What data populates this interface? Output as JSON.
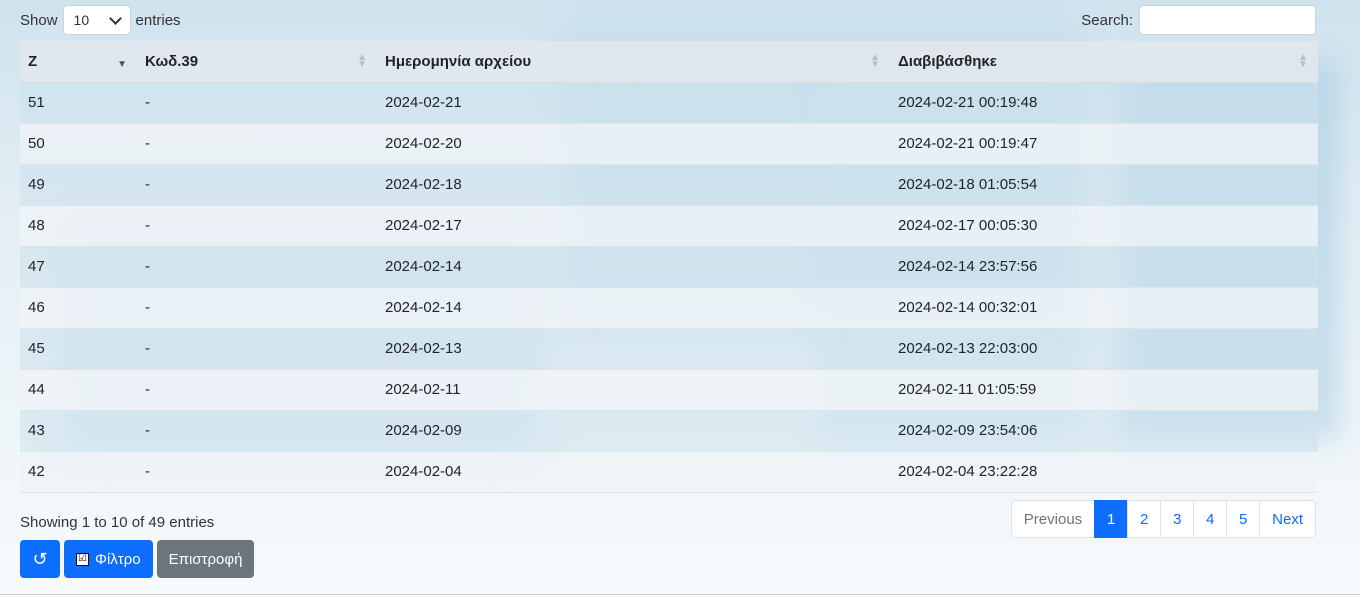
{
  "length_menu": {
    "prefix": "Show",
    "selected": "10",
    "suffix": "entries"
  },
  "search": {
    "label": "Search:",
    "value": "",
    "placeholder": ""
  },
  "table": {
    "columns": [
      "Z",
      "Κωδ.39",
      "Ημερομηνία αρχείου",
      "Διαβιβάσθηκε"
    ],
    "rows": [
      {
        "z": "51",
        "code39": "-",
        "file_date": "2024-02-21",
        "transmitted": "2024-02-21 00:19:48"
      },
      {
        "z": "50",
        "code39": "-",
        "file_date": "2024-02-20",
        "transmitted": "2024-02-21 00:19:47"
      },
      {
        "z": "49",
        "code39": "-",
        "file_date": "2024-02-18",
        "transmitted": "2024-02-18 01:05:54"
      },
      {
        "z": "48",
        "code39": "-",
        "file_date": "2024-02-17",
        "transmitted": "2024-02-17 00:05:30"
      },
      {
        "z": "47",
        "code39": "-",
        "file_date": "2024-02-14",
        "transmitted": "2024-02-14 23:57:56"
      },
      {
        "z": "46",
        "code39": "-",
        "file_date": "2024-02-14",
        "transmitted": "2024-02-14 00:32:01"
      },
      {
        "z": "45",
        "code39": "-",
        "file_date": "2024-02-13",
        "transmitted": "2024-02-13 22:03:00"
      },
      {
        "z": "44",
        "code39": "-",
        "file_date": "2024-02-11",
        "transmitted": "2024-02-11 01:05:59"
      },
      {
        "z": "43",
        "code39": "-",
        "file_date": "2024-02-09",
        "transmitted": "2024-02-09 23:54:06"
      },
      {
        "z": "42",
        "code39": "-",
        "file_date": "2024-02-04",
        "transmitted": "2024-02-04 23:22:28"
      }
    ]
  },
  "info_text": "Showing 1 to 10 of 49 entries",
  "pagination": {
    "previous": "Previous",
    "pages": [
      "1",
      "2",
      "3",
      "4",
      "5"
    ],
    "active_page": "1",
    "next": "Next"
  },
  "buttons": {
    "refresh_icon": "↺",
    "filter_check": "☑",
    "filter_label": "Φίλτρο",
    "back_label": "Επιστροφή"
  },
  "colors": {
    "primary": "#0d6efd",
    "secondary": "#6c757d"
  }
}
